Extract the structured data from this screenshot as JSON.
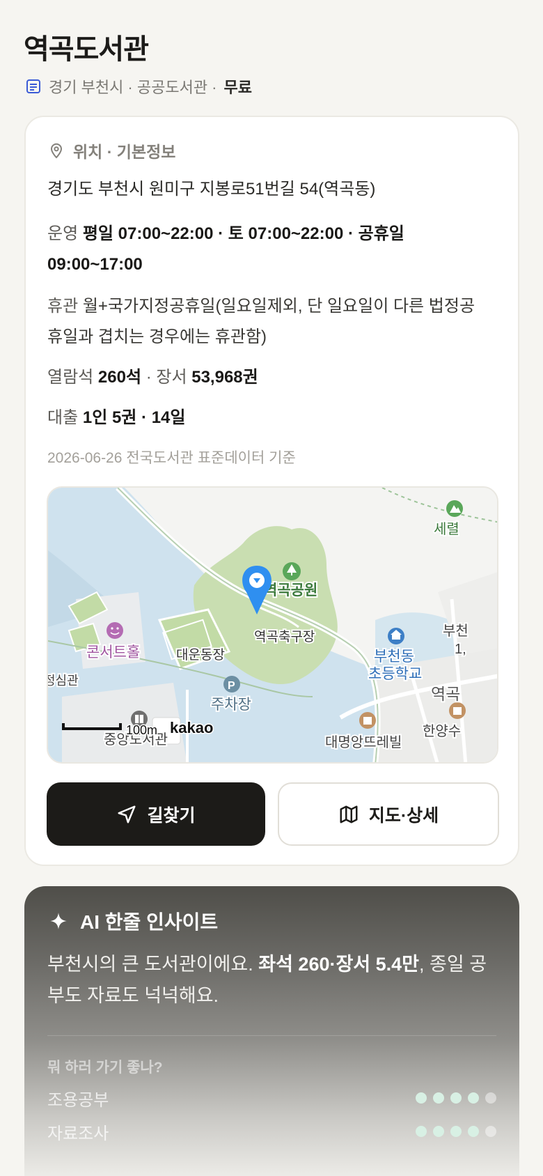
{
  "library": {
    "name": "역곡도서관",
    "meta": "경기 부천시 · 공공도서관 · ",
    "fee": "무료"
  },
  "info": {
    "section_title": "위치 · 기본정보",
    "address": "경기도 부천시 원미구 지봉로51번길 54(역곡동)",
    "hours_label": "운영",
    "hours_value": "평일 07:00~22:00 · 토 07:00~22:00 · 공휴일 09:00~17:00",
    "closed_label": "휴관",
    "closed_value": "월+국가지정공휴일(일요일제외, 단 일요일이 다른 법정공휴일과 겹치는 경우에는 휴관함)",
    "seats_label": "열람석",
    "seats_value": "260석",
    "books_label": "장서",
    "books_value": "53,968권",
    "loan_label": "대출",
    "loan_value": "1인 5권 · 14일",
    "basis": "2026-06-26 전국도서관 표준데이터 기준"
  },
  "map": {
    "labels": {
      "park": "역곡공원",
      "football": "역곡축구장",
      "concert": "콘서트홀",
      "stadium": "대운동장",
      "parking": "주차장",
      "school_line1": "부천동",
      "school_line2": "초등학교",
      "hall_partial": "정심관",
      "library_partial": "중앙도서관",
      "apartment": "대명앙뜨레빌",
      "hanyang": "한양수",
      "station_partial": "역곡",
      "top_right": "세렬",
      "right_edge1": "부천",
      "right_edge2": "1,",
      "scale": "100m",
      "brand": "kakao"
    }
  },
  "buttons": {
    "directions": "길찾기",
    "map_detail": "지도·상세"
  },
  "ai": {
    "title": "AI 한줄 인사이트",
    "text_1": "부천시의 큰 도서관이에요. ",
    "text_bold": "좌석 260·장서 5.4만",
    "text_2": ", 종일 공부도 자료도 넉넉해요.",
    "question": "뭐 하러 가기 좋나?",
    "ratings": [
      {
        "label": "조용공부",
        "score": 4,
        "max": 5
      },
      {
        "label": "자료조사",
        "score": 4,
        "max": 5
      }
    ]
  },
  "colors": {
    "accent_blue": "#2f8ff0",
    "park_green": "#c8ddb0",
    "water_blue": "#cfe2ee",
    "dark_button": "#1c1b18"
  }
}
